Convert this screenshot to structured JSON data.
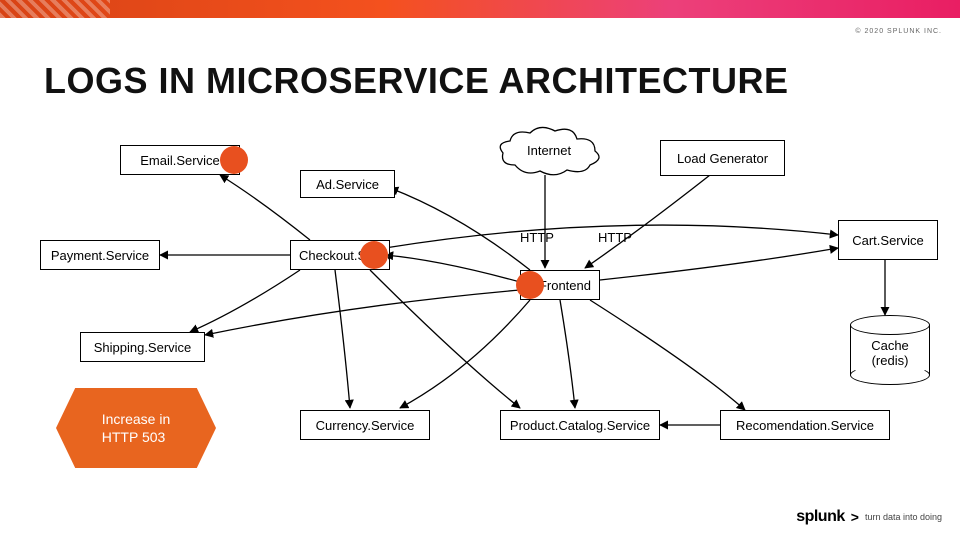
{
  "copyright": "© 2020 SPLUNK INC.",
  "title": "LOGS IN MICROSERVICE ARCHITECTURE",
  "nodes": {
    "email": "Email.Service",
    "ad": "Ad.Service",
    "payment": "Payment.Service",
    "checkout": "Checkout.Service",
    "shipping": "Shipping.Service",
    "currency": "Currency.Service",
    "frontend": "Frontend",
    "productcatalog": "Product.Catalog.Service",
    "recommendation": "Recomendation.Service",
    "cart": "Cart.Service",
    "loadgen": "Load Generator",
    "internet": "Internet",
    "cache": "Cache\n(redis)"
  },
  "labels": {
    "http1": "HTTP",
    "http2": "HTTP"
  },
  "callout": {
    "line1": "Increase in",
    "line2": "HTTP 503"
  },
  "brand": {
    "logo": "splunk",
    "arrow": ">",
    "tagline": "turn data into doing"
  }
}
